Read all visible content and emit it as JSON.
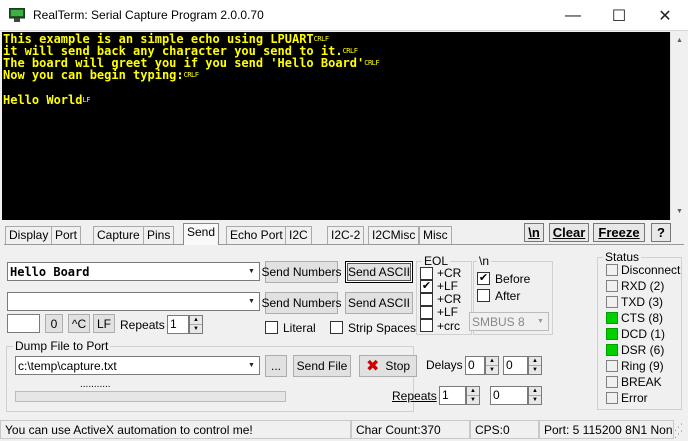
{
  "window": {
    "title": "RealTerm: Serial Capture Program 2.0.0.70",
    "minimize": "—",
    "maximize": "☐",
    "close": "✕"
  },
  "terminal": {
    "lines": [
      {
        "text": "This example is an simple echo using LPUART",
        "ctl": "CRLF"
      },
      {
        "text": "it will send back any character you send to it.",
        "ctl": "CRLF"
      },
      {
        "text": "The board will greet you if you send 'Hello Board'",
        "ctl": "CRLF"
      },
      {
        "text": "Now you can begin typing:",
        "ctl": "CRLF"
      },
      {
        "text": "",
        "ctl": ""
      },
      {
        "text": "Hello World",
        "ctl": "LF"
      }
    ],
    "fg": "#ffff00",
    "bg": "#000000"
  },
  "tabs": [
    "Display",
    "Port",
    "Capture",
    "Pins",
    "Send",
    "Echo Port",
    "I2C",
    "I2C-2",
    "I2CMisc",
    "Misc"
  ],
  "active_tab": "Send",
  "top_buttons": {
    "newline": "\\n",
    "clear": "Clear",
    "freeze": "Freeze",
    "help": "?"
  },
  "send": {
    "input1_value": "Hello Board",
    "input2_value": "",
    "send_numbers": "Send Numbers",
    "send_ascii": "Send ASCII",
    "char_value": "",
    "zero_btn": "0",
    "ctrlc_btn": "^C",
    "lf_btn": "LF",
    "repeats_label": "Repeats",
    "repeats_value": "1",
    "literal_label": "Literal",
    "strip_spaces_label": "Strip Spaces"
  },
  "eol": {
    "title": "EOL",
    "row1": [
      {
        "label": "+CR",
        "checked": false
      },
      {
        "label": "+LF",
        "checked": true
      }
    ],
    "row2": [
      {
        "label": "+CR",
        "checked": false
      },
      {
        "label": "+LF",
        "checked": false
      }
    ],
    "crc_label": "+crc",
    "crc_checked": false
  },
  "newline_group": {
    "title": "\\n",
    "before_label": "Before",
    "before_checked": true,
    "after_label": "After",
    "after_checked": false,
    "smbus_value": "SMBUS 8"
  },
  "dump": {
    "title": "Dump File to Port",
    "file_value": "c:\\temp\\capture.txt",
    "browse": "...",
    "send_file": "Send File",
    "stop": "Stop",
    "delays_label": "Delays",
    "delay1": "0",
    "delay2": "0",
    "repeats_label": "Repeats",
    "repeats1": "1",
    "repeats2": "0",
    "progress_text": "..........."
  },
  "status": {
    "title": "Status",
    "items": [
      {
        "label": "Disconnect",
        "on": false
      },
      {
        "label": "RXD (2)",
        "on": false
      },
      {
        "label": "TXD (3)",
        "on": false
      },
      {
        "label": "CTS (8)",
        "on": true
      },
      {
        "label": "DCD (1)",
        "on": true
      },
      {
        "label": "DSR (6)",
        "on": true
      },
      {
        "label": "Ring (9)",
        "on": false
      },
      {
        "label": "BREAK",
        "on": false
      },
      {
        "label": "Error",
        "on": false
      }
    ],
    "led_on_color": "#00d000"
  },
  "statusbar": {
    "message": "You can use ActiveX automation to control me!",
    "char_count": "Char Count:370",
    "cps": "CPS:0",
    "port": "Port: 5 115200 8N1 Non"
  }
}
